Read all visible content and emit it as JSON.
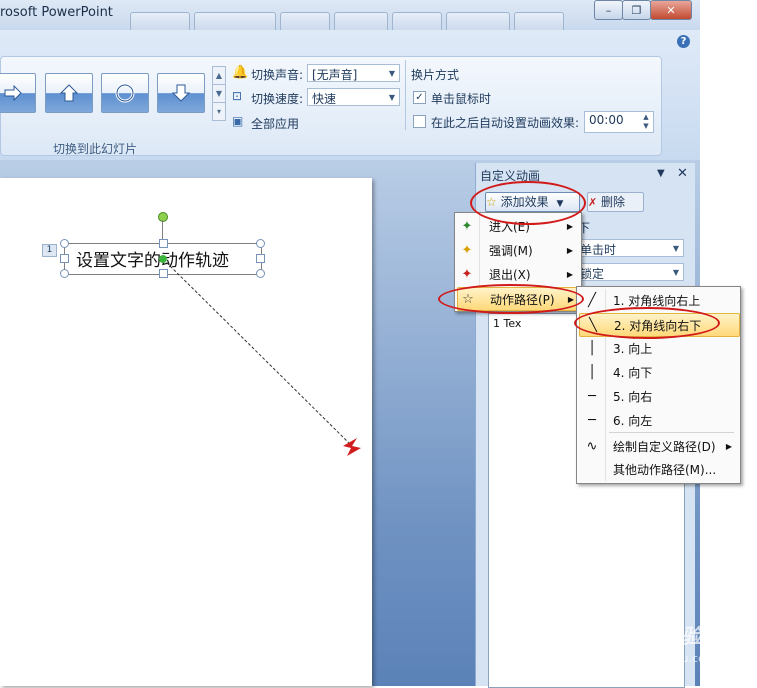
{
  "window": {
    "title": "rosoft PowerPoint",
    "minimize_glyph": "–",
    "restore_glyph": "❐",
    "close_glyph": "✕"
  },
  "ribbon": {
    "help_glyph": "?",
    "sound_label": "切换声音:",
    "sound_value": "[无声音]",
    "speed_label": "切换速度:",
    "speed_value": "快速",
    "apply_all_label": "全部应用",
    "advance_group_label": "换片方式",
    "on_click_label": "单击鼠标时",
    "on_click_checked": true,
    "auto_after_label": "在此之后自动设置动画效果:",
    "auto_after_checked": false,
    "auto_after_value": "00:00",
    "group_label": "切换到此幻灯片"
  },
  "slide": {
    "textbox_text": "设置文字的动作轨迹",
    "anim_tag": "1"
  },
  "pane": {
    "title": "自定义动画",
    "add_effect_label": "添加效果",
    "delete_label": "删除",
    "change_label": "下",
    "start_value": "单击时",
    "dir_value": "锁定",
    "list_row_text": "1  Tex"
  },
  "menu_effects": [
    {
      "label": "进入(E)",
      "icon": "enter-star-icon",
      "glyph": "✦",
      "color": "#2d8a2d"
    },
    {
      "label": "强调(M)",
      "icon": "emphasis-star-icon",
      "glyph": "✦",
      "color": "#d6a000"
    },
    {
      "label": "退出(X)",
      "icon": "exit-star-icon",
      "glyph": "✦",
      "color": "#c62020"
    },
    {
      "label": "动作路径(P)",
      "icon": "motion-path-star-icon",
      "glyph": "☆",
      "color": "#444444"
    }
  ],
  "menu_paths": [
    {
      "label": "1. 对角线向右上",
      "glyph": "╱"
    },
    {
      "label": "2. 对角线向右下",
      "glyph": "╲"
    },
    {
      "label": "3. 向上",
      "glyph": "│"
    },
    {
      "label": "4. 向下",
      "glyph": "│"
    },
    {
      "label": "5. 向右",
      "glyph": "─"
    },
    {
      "label": "6. 向左",
      "glyph": "─"
    },
    {
      "label": "绘制自定义路径(D)",
      "glyph": "∿"
    },
    {
      "label": "其他动作路径(M)...",
      "glyph": ""
    }
  ],
  "watermark": {
    "main": "Baidu 经验",
    "sub": "jingyan.baidu.com"
  },
  "colors": {
    "highlight_ellipse": "#d11a1a",
    "menu_highlight": "#ffd97a"
  }
}
